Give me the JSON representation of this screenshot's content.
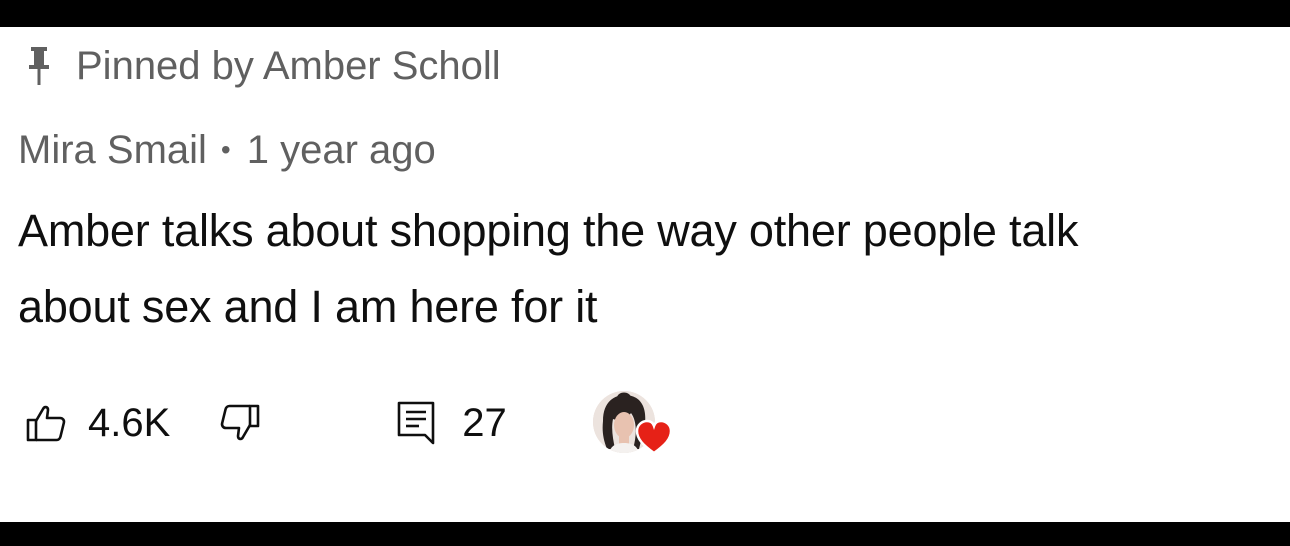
{
  "pinned": {
    "icon": "pin-icon",
    "text": "Pinned by Amber Scholl"
  },
  "comment": {
    "author": "Mira Smail",
    "separator": "•",
    "time": "1 year ago",
    "lines": [
      "Amber talks about shopping the way other people talk",
      "about sex and I am here for it"
    ]
  },
  "actions": {
    "like_icon": "thumbs-up-icon",
    "like_count": "4.6K",
    "dislike_icon": "thumbs-down-icon",
    "reply_icon": "comment-icon",
    "reply_count": "27",
    "creator_heart_icon": "heart-icon",
    "heart_color": "#e62117"
  },
  "colors": {
    "secondary_text": "#606060",
    "primary_text": "#0f0f0f",
    "background": "#ffffff"
  }
}
